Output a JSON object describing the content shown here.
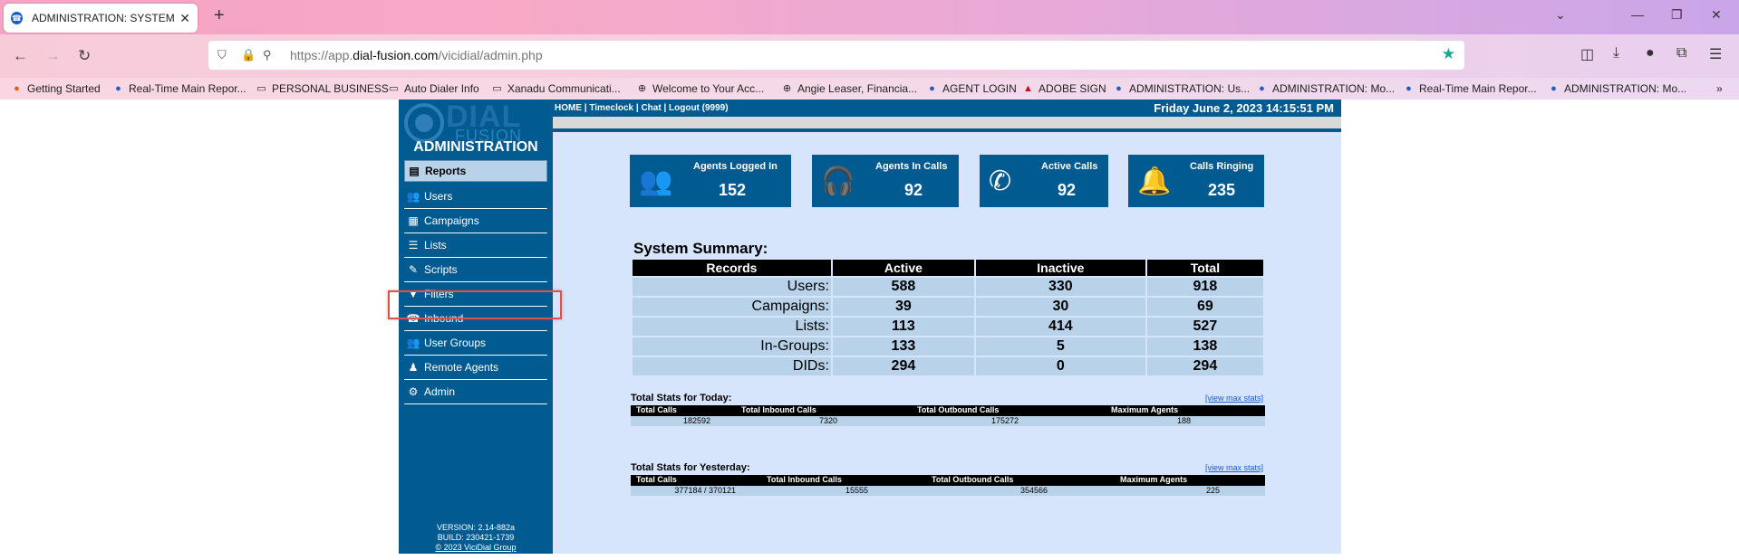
{
  "browser": {
    "tab_title": "ADMINISTRATION: SYSTEM SNA",
    "url_prefix": "https://app.",
    "url_domain": "dial-fusion.com",
    "url_path": "/vicidial/admin.php",
    "bookmarks": [
      "Getting Started",
      "Real-Time Main Repor...",
      "PERSONAL BUSINESS",
      "Auto Dialer Info",
      "Xanadu Communicati...",
      "Welcome to Your Acc...",
      "Angie Leaser, Financia...",
      "AGENT LOGIN",
      "ADOBE SIGN",
      "ADMINISTRATION: Us...",
      "ADMINISTRATION: Mo...",
      "Real-Time Main Repor...",
      "ADMINISTRATION: Mo..."
    ]
  },
  "logo": {
    "line1": "DIAL",
    "line2": "FUSION"
  },
  "admin_title": "ADMINISTRATION",
  "menu": [
    {
      "label": "Reports",
      "icon": "reports-icon",
      "glyph": "▤"
    },
    {
      "label": "Users",
      "icon": "users-icon",
      "glyph": "👥"
    },
    {
      "label": "Campaigns",
      "icon": "campaigns-icon",
      "glyph": "▦"
    },
    {
      "label": "Lists",
      "icon": "lists-icon",
      "glyph": "☰"
    },
    {
      "label": "Scripts",
      "icon": "scripts-icon",
      "glyph": "✎"
    },
    {
      "label": "Filters",
      "icon": "filter-icon",
      "glyph": "▼"
    },
    {
      "label": "Inbound",
      "icon": "inbound-icon",
      "glyph": "☎"
    },
    {
      "label": "User Groups",
      "icon": "user-groups-icon",
      "glyph": "👥"
    },
    {
      "label": "Remote Agents",
      "icon": "remote-agents-icon",
      "glyph": "♟"
    },
    {
      "label": "Admin",
      "icon": "gear-icon",
      "glyph": "⚙"
    }
  ],
  "version": {
    "version": "VERSION: 2.14-882a",
    "build": "BUILD: 230421-1739",
    "copyright": "© 2023 ViciDial Group"
  },
  "topbar": {
    "links": "HOME | Timeclock | Chat | Logout (9999)",
    "datetime": "Friday June 2, 2023 14:15:51 PM"
  },
  "stat_cards": [
    {
      "label": "Agents Logged In",
      "value": "152",
      "icon": "agents-logged-in-icon"
    },
    {
      "label": "Agents In Calls",
      "value": "92",
      "icon": "agents-in-calls-icon"
    },
    {
      "label": "Active Calls",
      "value": "92",
      "icon": "phone-icon"
    },
    {
      "label": "Calls Ringing",
      "value": "235",
      "icon": "bell-icon"
    }
  ],
  "system_summary": {
    "title": "System Summary:",
    "headers": [
      "Records",
      "Active",
      "Inactive",
      "Total"
    ],
    "rows": [
      [
        "Users:",
        "588",
        "330",
        "918"
      ],
      [
        "Campaigns:",
        "39",
        "30",
        "69"
      ],
      [
        "Lists:",
        "113",
        "414",
        "527"
      ],
      [
        "In-Groups:",
        "133",
        "5",
        "138"
      ],
      [
        "DIDs:",
        "294",
        "0",
        "294"
      ]
    ]
  },
  "stats_today": {
    "title": "Total Stats for Today:",
    "link": "[view max stats]",
    "headers": [
      "Total Calls",
      "Total Inbound Calls",
      "Total Outbound Calls",
      "Maximum Agents"
    ],
    "values": [
      "182592",
      "7320",
      "175272",
      "188"
    ]
  },
  "stats_yesterday": {
    "title": "Total Stats for Yesterday:",
    "link": "[view max stats]",
    "headers": [
      "Total Calls",
      "Total Inbound Calls",
      "Total Outbound Calls",
      "Maximum Agents"
    ],
    "values": [
      "377184 / 370121",
      "15555",
      "354566",
      "225"
    ]
  },
  "colors": {
    "navy": "#015b91",
    "page_bg": "#d6e4fc",
    "row_bg": "#b8d2ea",
    "highlight": "#d9534f"
  }
}
